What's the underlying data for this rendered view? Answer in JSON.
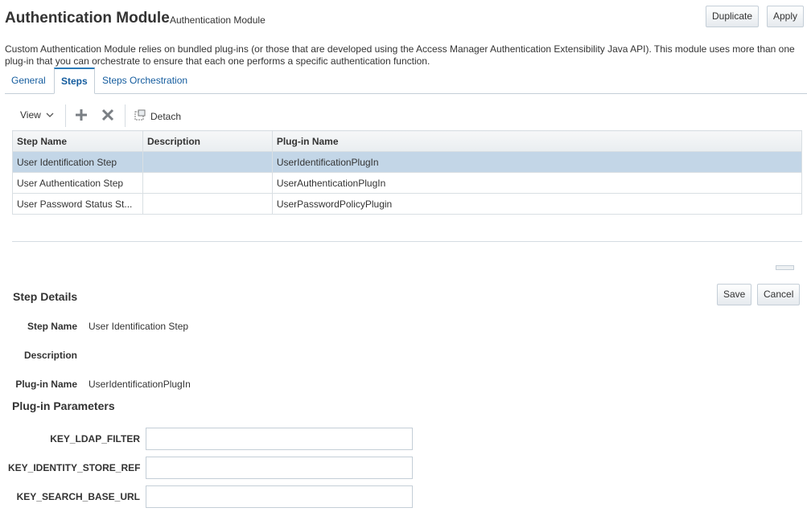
{
  "header": {
    "title": "Authentication Module",
    "subtitle": "Authentication Module",
    "duplicate_label": "Duplicate",
    "apply_label": "Apply"
  },
  "description": "Custom Authentication Module relies on bundled plug-ins (or those that are developed using the Access Manager Authentication Extensibility Java API). This module uses more than one plug-in that you can orchestrate to ensure that each one performs a specific authentication function.",
  "tabs": [
    {
      "label": "General",
      "active": false
    },
    {
      "label": "Steps",
      "active": true
    },
    {
      "label": "Steps Orchestration",
      "active": false
    }
  ],
  "toolbar": {
    "view_label": "View",
    "add_icon": "plus-icon",
    "delete_icon": "x-icon",
    "detach_icon": "detach-icon",
    "detach_label": "Detach"
  },
  "steps_table": {
    "columns": [
      "Step Name",
      "Description",
      "Plug-in Name"
    ],
    "rows": [
      {
        "step_name": "User Identification Step",
        "description": "",
        "plugin_name": "UserIdentificationPlugIn",
        "selected": true
      },
      {
        "step_name": "User Authentication Step",
        "description": "",
        "plugin_name": "UserAuthenticationPlugIn",
        "selected": false
      },
      {
        "step_name": "User Password Status St...",
        "description": "",
        "plugin_name": "UserPasswordPolicyPlugin",
        "selected": false
      }
    ]
  },
  "details": {
    "title": "Step Details",
    "save_label": "Save",
    "cancel_label": "Cancel",
    "step_name_label": "Step Name",
    "step_name_value": "User Identification Step",
    "description_label": "Description",
    "description_value": "",
    "plugin_name_label": "Plug-in Name",
    "plugin_name_value": "UserIdentificationPlugIn"
  },
  "parameters": {
    "title": "Plug-in Parameters",
    "fields": [
      {
        "label": "KEY_LDAP_FILTER",
        "value": ""
      },
      {
        "label": "KEY_IDENTITY_STORE_REF",
        "value": ""
      },
      {
        "label": "KEY_SEARCH_BASE_URL",
        "value": ""
      }
    ]
  },
  "colors": {
    "link": "#145c9e",
    "selected_row": "#c3d6e7",
    "border": "#c4ced7"
  }
}
